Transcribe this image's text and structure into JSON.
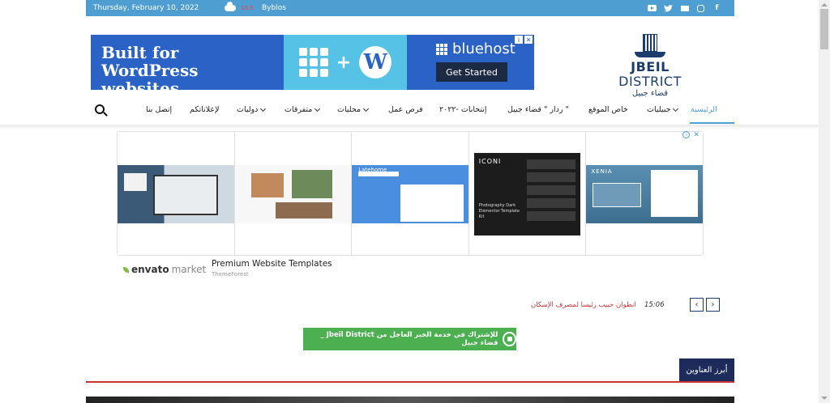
{
  "topbar": {
    "date": "Thursday, February 10, 2022",
    "temperature": "10.5",
    "city": "Byblos",
    "social_icons": [
      "youtube-icon",
      "twitter-icon",
      "mail-icon",
      "instagram-icon",
      "facebook-icon"
    ]
  },
  "banner_ad": {
    "headline_line1": "Built for",
    "headline_line2": "WordPress websites.",
    "brand": "bluehost",
    "cta": "Get Started"
  },
  "logo": {
    "name_bold": "JBEIL",
    "name_light": " DISTRICT",
    "arabic": "قضاء جبيل"
  },
  "nav": {
    "items": [
      {
        "label": "الرئيسية",
        "active": true
      },
      {
        "label": "جبيليات",
        "dropdown": true
      },
      {
        "label": "خاص الموقع"
      },
      {
        "label": "ردار \" قضاء جبيل \""
      },
      {
        "label": "إنتخابات -٢٠٢٢"
      },
      {
        "label": "فرص عمل"
      },
      {
        "label": "محليات",
        "dropdown": true
      },
      {
        "label": "متفرقات",
        "dropdown": true
      },
      {
        "label": "دوليات",
        "dropdown": true
      },
      {
        "label": "لإعلاناتكم"
      },
      {
        "label": "إتصل بنا"
      }
    ]
  },
  "themeforest_ad": {
    "thumb4_title": "ICONI",
    "thumb4_subtitle": "Photography Dark Elementor Template Kit",
    "thumb5_title": "XENIA",
    "thumb3_brand": "Latehome",
    "envato_bold": "envato",
    "envato_light": "market",
    "title": "Premium Website Templates",
    "subtitle": "ThemeForest"
  },
  "ticker": {
    "time": "15:06",
    "text": "انطوان حبيب رئيسا لمصرف الإسكان"
  },
  "whatsapp_cta": {
    "label": "للإشتراك في خدمة الخبر العاجل من Jbeil District _ قضاء جبيل"
  },
  "headlines": {
    "tab_label": "أبرز العناوين"
  },
  "colors": {
    "topbar": "#4f9ed2",
    "navy": "#1c2b5a",
    "accent_red": "#c8343a",
    "whatsapp_green": "#4caf50"
  }
}
